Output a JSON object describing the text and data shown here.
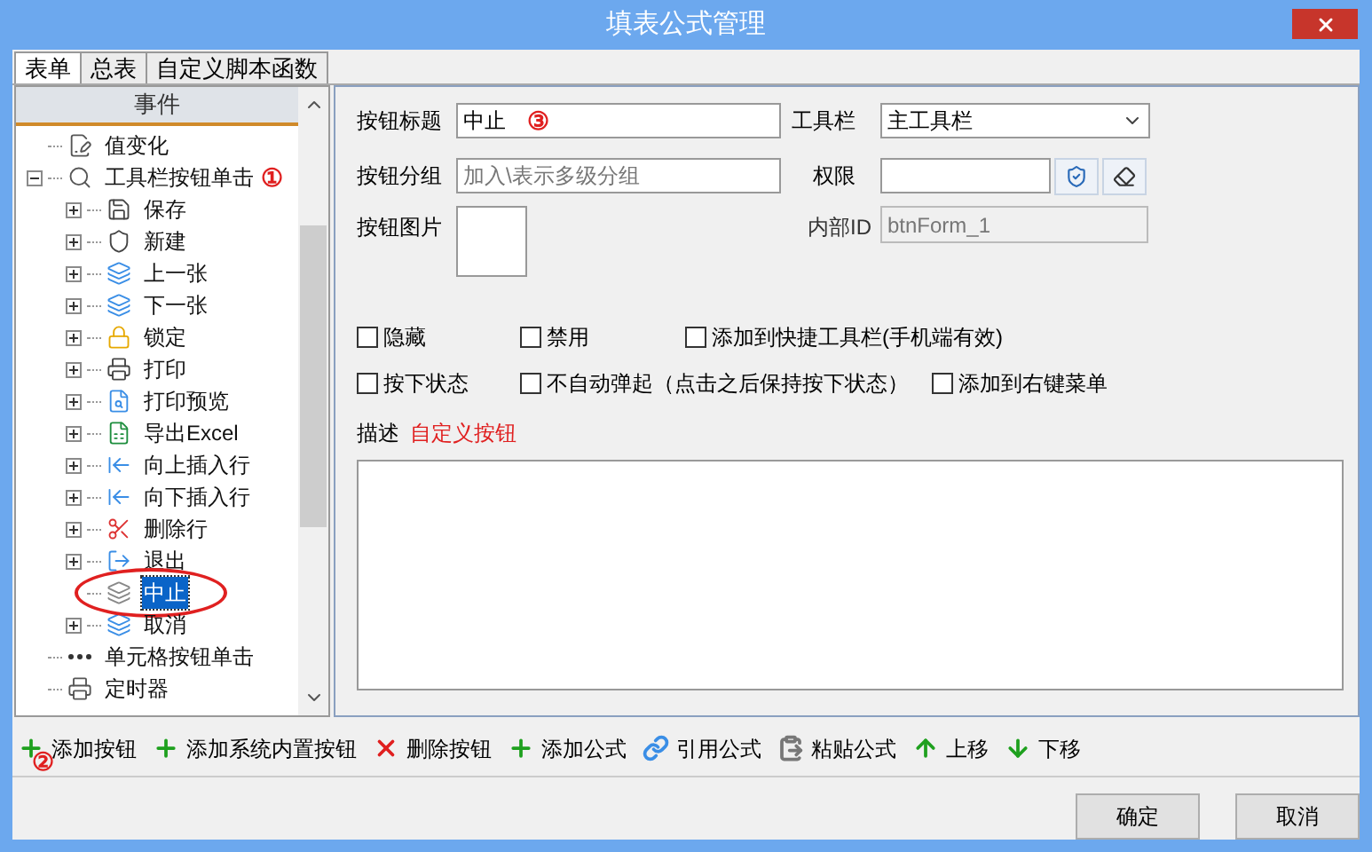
{
  "window": {
    "title": "填表公式管理"
  },
  "tabs": [
    {
      "label": "表单",
      "selected": true
    },
    {
      "label": "总表",
      "selected": false
    },
    {
      "label": "自定义脚本函数",
      "selected": false
    }
  ],
  "tree": {
    "header": "事件",
    "items": [
      {
        "label": "值变化",
        "selected": false
      },
      {
        "label": "工具栏按钮单击",
        "selected": false,
        "expanded": true,
        "annotation": "①",
        "children": [
          {
            "label": "保存",
            "selected": false,
            "expanded": false
          },
          {
            "label": "新建",
            "selected": false,
            "expanded": false
          },
          {
            "label": "上一张",
            "selected": false,
            "expanded": false
          },
          {
            "label": "下一张",
            "selected": false,
            "expanded": false
          },
          {
            "label": "锁定",
            "selected": false,
            "expanded": false
          },
          {
            "label": "打印",
            "selected": false,
            "expanded": false
          },
          {
            "label": "打印预览",
            "selected": false,
            "expanded": false
          },
          {
            "label": "导出Excel",
            "selected": false,
            "expanded": false
          },
          {
            "label": "向上插入行",
            "selected": false,
            "expanded": false
          },
          {
            "label": "向下插入行",
            "selected": false,
            "expanded": false
          },
          {
            "label": "删除行",
            "selected": false,
            "expanded": false
          },
          {
            "label": "退出",
            "selected": false,
            "expanded": false
          },
          {
            "label": "中止",
            "selected": true,
            "circled": true
          },
          {
            "label": "取消",
            "selected": false,
            "expanded": false
          }
        ]
      },
      {
        "label": "单元格按钮单击",
        "selected": false
      },
      {
        "label": "定时器",
        "selected": false
      }
    ]
  },
  "form": {
    "title_label": "按钮标题",
    "title_value": "中止",
    "title_annotation": "③",
    "toolbar_label": "工具栏",
    "toolbar_value": "主工具栏",
    "group_label": "按钮分组",
    "group_placeholder": "加入\\表示多级分组",
    "permission_label": "权限",
    "image_label": "按钮图片",
    "id_label": "内部ID",
    "id_value": "btnForm_1",
    "checkboxes": [
      {
        "label": "隐藏",
        "checked": false
      },
      {
        "label": "禁用",
        "checked": false
      },
      {
        "label": "添加到快捷工具栏(手机端有效)",
        "checked": false
      },
      {
        "label": "按下状态",
        "checked": false
      },
      {
        "label": "不自动弹起（点击之后保持按下状态）",
        "checked": false
      },
      {
        "label": "添加到右键菜单",
        "checked": false
      }
    ],
    "description_label": "描述",
    "description_value": "自定义按钮"
  },
  "toolbar": [
    {
      "label": "添加按钮",
      "annotation": "②"
    },
    {
      "label": "添加系统内置按钮"
    },
    {
      "label": "删除按钮"
    },
    {
      "label": "添加公式"
    },
    {
      "label": "引用公式"
    },
    {
      "label": "粘贴公式"
    },
    {
      "label": "上移"
    },
    {
      "label": "下移"
    }
  ],
  "buttons": [
    "确定",
    "取消"
  ]
}
